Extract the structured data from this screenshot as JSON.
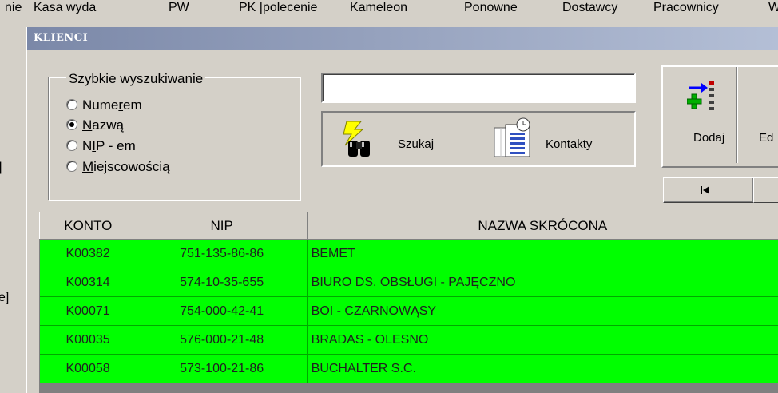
{
  "menubar": {
    "items": [
      "nie",
      "Kasa wyda",
      "PW",
      "PK |polecenie",
      "Kameleon",
      "Ponowne",
      "Dostawcy",
      "Pracownicy",
      "W"
    ]
  },
  "left_strip": {
    "fragments": [
      "]",
      "e]"
    ]
  },
  "window": {
    "title": "KLIENCI"
  },
  "quick_search": {
    "legend": "Szybkie wyszukiwanie",
    "options": [
      {
        "pre": "Nume",
        "u": "r",
        "post": "em",
        "selected": false
      },
      {
        "pre": "",
        "u": "N",
        "post": "azwą",
        "selected": true
      },
      {
        "pre": "N",
        "u": "I",
        "post": "P - em",
        "selected": false
      },
      {
        "pre": "",
        "u": "M",
        "post": "iejscowością",
        "selected": false
      }
    ],
    "input_value": ""
  },
  "actions": {
    "search": {
      "u": "S",
      "rest": "zukaj",
      "icon": "binoculars-icon"
    },
    "contacts": {
      "u": "K",
      "rest": "ontakty",
      "icon": "contacts-notebook-icon"
    }
  },
  "toolbar": {
    "add_label": "Dodaj",
    "edit_label": "Ed",
    "nav_first_icon": "first-record-icon"
  },
  "table": {
    "columns": [
      "KONTO",
      "NIP",
      "NAZWA SKRÓCONA"
    ],
    "rows": [
      [
        "K00382",
        "751-135-86-86",
        "BEMET"
      ],
      [
        "K00314",
        "574-10-35-655",
        "BIURO DS. OBSŁUGI - PAJĘCZNO"
      ],
      [
        "K00071",
        "754-000-42-41",
        "BOI - CZARNOWĄSY"
      ],
      [
        "K00035",
        "576-000-21-48",
        "BRADAS - OLESNO"
      ],
      [
        "K00058",
        "573-100-21-86",
        "BUCHALTER S.C."
      ]
    ]
  },
  "colors": {
    "row_highlight": "#00ff00",
    "title_bar": "#7b88a8"
  }
}
